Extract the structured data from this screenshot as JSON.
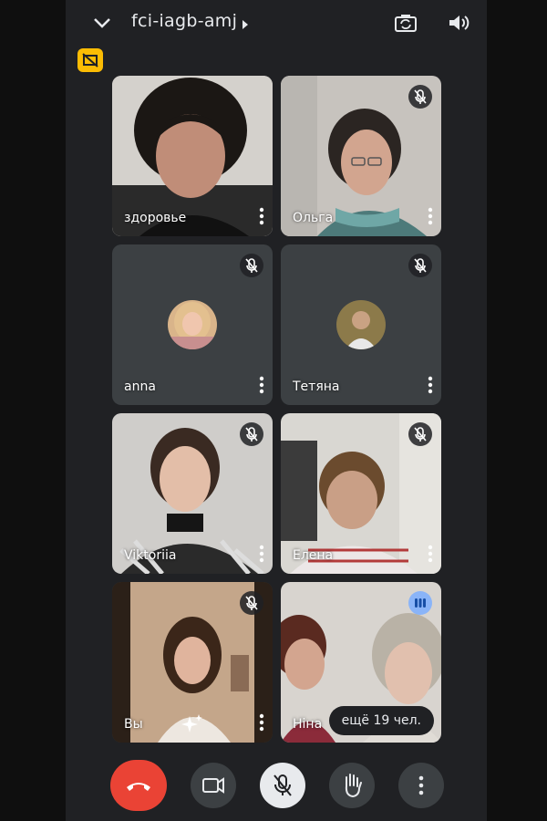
{
  "meeting": {
    "code": "fci-iagb-amj"
  },
  "colors": {
    "end_call": "#ea4335",
    "speaking": "#8ab4f8",
    "badge": "#fbbc04",
    "tile": "#3c4043",
    "bg": "#202124"
  },
  "header": {
    "icons": [
      "chevron-down-icon",
      "caret-right-icon",
      "switch-camera-icon",
      "speaker-icon"
    ]
  },
  "participants": [
    {
      "name": "здоровье",
      "muted": false
    },
    {
      "name": "Ольга",
      "muted": true
    },
    {
      "name": "anna",
      "muted": true
    },
    {
      "name": "Тетяна",
      "muted": true
    },
    {
      "name": "Viktoriia",
      "muted": true
    },
    {
      "name": "Елена",
      "muted": true
    },
    {
      "name": "Вы",
      "muted": true
    },
    {
      "name": "Ніна",
      "muted": false,
      "speaking": true
    }
  ],
  "more_people": {
    "label": "ещё 19 чел."
  },
  "controls": [
    "end-call",
    "camera",
    "microphone-off",
    "raise-hand",
    "more-options"
  ]
}
